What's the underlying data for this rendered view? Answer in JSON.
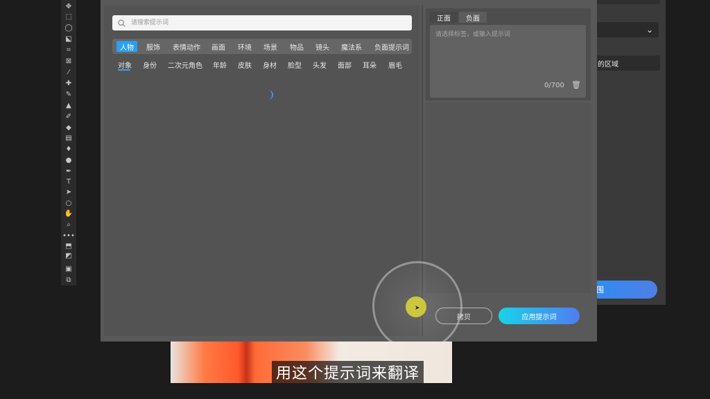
{
  "search": {
    "placeholder": "请搜索提示词"
  },
  "categories": [
    "人物",
    "服饰",
    "表情动作",
    "画面",
    "环境",
    "场景",
    "物品",
    "镜头",
    "魔法系",
    "负面提示词"
  ],
  "active_category": "人物",
  "subcategories": [
    "对象",
    "身份",
    "二次元角色",
    "年龄",
    "皮肤",
    "身材",
    "脸型",
    "头发",
    "面部",
    "耳朵",
    "眉毛"
  ],
  "active_subcategory": "对象",
  "prompt_panel": {
    "tabs": [
      "正面",
      "负面"
    ],
    "placeholder": "请选择标签，或输入提示词",
    "counter": "0/700"
  },
  "buttons": {
    "copy": "拷贝",
    "apply": "应用提示词"
  },
  "background_panel": {
    "area_label": "的区域",
    "action_label": "围"
  },
  "subtitle": "用这个提示词来翻译",
  "colors": {
    "accent": "#2aa0f0",
    "apply_start": "#19d3e8",
    "apply_end": "#4f7cf0"
  }
}
